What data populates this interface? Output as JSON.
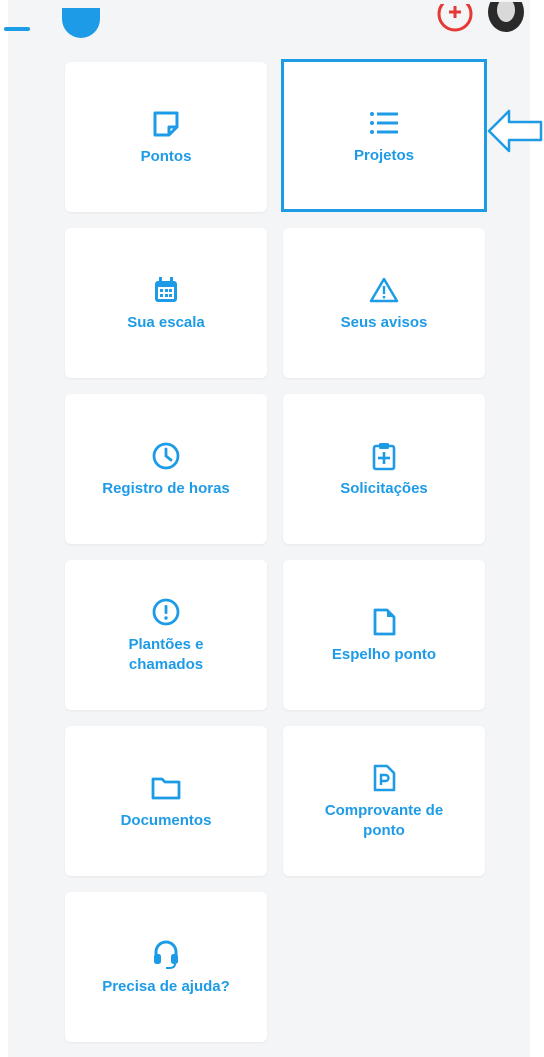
{
  "header": {
    "menu_icon": "menu-icon",
    "logo_icon": "logo-icon",
    "notification_icon": "plus-circle-icon",
    "avatar_icon": "avatar"
  },
  "colors": {
    "accent": "#1e9be6",
    "background": "#f4f5f7",
    "tile": "#ffffff",
    "alert": "#e53935"
  },
  "tiles": [
    {
      "label": "Pontos",
      "icon": "sticky-note-icon"
    },
    {
      "label": "Projetos",
      "icon": "list-icon",
      "highlighted": true
    },
    {
      "label": "Sua escala",
      "icon": "calendar-icon"
    },
    {
      "label": "Seus avisos",
      "icon": "warning-icon"
    },
    {
      "label": "Registro de horas",
      "icon": "clock-icon"
    },
    {
      "label": "Solicitações",
      "icon": "clipboard-plus-icon"
    },
    {
      "label": "Plantões e\nchamados",
      "icon": "alert-circle-icon"
    },
    {
      "label": "Espelho ponto",
      "icon": "document-icon"
    },
    {
      "label": "Documentos",
      "icon": "folder-icon"
    },
    {
      "label": "Comprovante de\nponto",
      "icon": "parking-document-icon"
    },
    {
      "label": "Precisa de ajuda?",
      "icon": "headset-icon"
    }
  ],
  "pointer": {
    "icon": "arrow-left-icon"
  }
}
